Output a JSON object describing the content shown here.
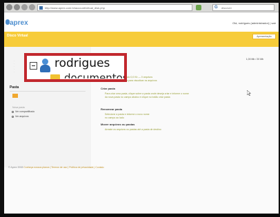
{
  "browser": {
    "url": "http://www.aprex.com.br/account/virtual_disk.php",
    "search_placeholder": "discover"
  },
  "header": {
    "logo": "aprex",
    "user_info": "Olá, rodrigues (administrador) | sair",
    "buttons": [
      "Início",
      "Meus dados",
      "Ajuda"
    ]
  },
  "band": {
    "title": "Disco Virtual",
    "tabs": [
      "Início",
      "Arquivos",
      "Compartilhar",
      "Lixeira",
      "Backup",
      "Pastas",
      "Preferências",
      "Histórico"
    ],
    "active_tab_index": 4,
    "settings_label": "Apresentação"
  },
  "sidebar": {
    "heading": "Pasta",
    "caption": "Nova pasta",
    "links": [
      "Ver compartilhado",
      "Ver arquivos"
    ]
  },
  "tree": {
    "root": "rodrigues",
    "child": "documentos"
  },
  "main": {
    "meta": "1,00 Mb / 20 Mb",
    "lines_top": [
      "Tamanho total ocupado 0,0 Kb — 0 arquivos",
      "Clique em uma pasta para visualizar os arquivos"
    ],
    "sections": [
      {
        "title": "Criar pasta",
        "lines": [
          "Para criar uma pasta, clique sobre a pasta onde deseja criar e informe o nome",
          "da nova pasta no campo abaixo e clique no botão criar pasta"
        ]
      },
      {
        "title": "Renomear pasta",
        "lines": [
          "Selecione a pasta e informe o novo nome",
          "no campo ao lado"
        ]
      },
      {
        "title": "Mover arquivos ou pastas",
        "lines": [
          "Arraste os arquivos ou pastas até a pasta de destino"
        ]
      }
    ]
  },
  "footer": {
    "copyright": "© Aprex 2008",
    "links": "Conheça nossos planos | Termos de uso | Política de privacidade | Contato"
  },
  "colors": {
    "band": "#f7cc3a",
    "accent": "#f0a830",
    "highlight_border": "#c1272d",
    "logo": "#4f8fcf"
  }
}
